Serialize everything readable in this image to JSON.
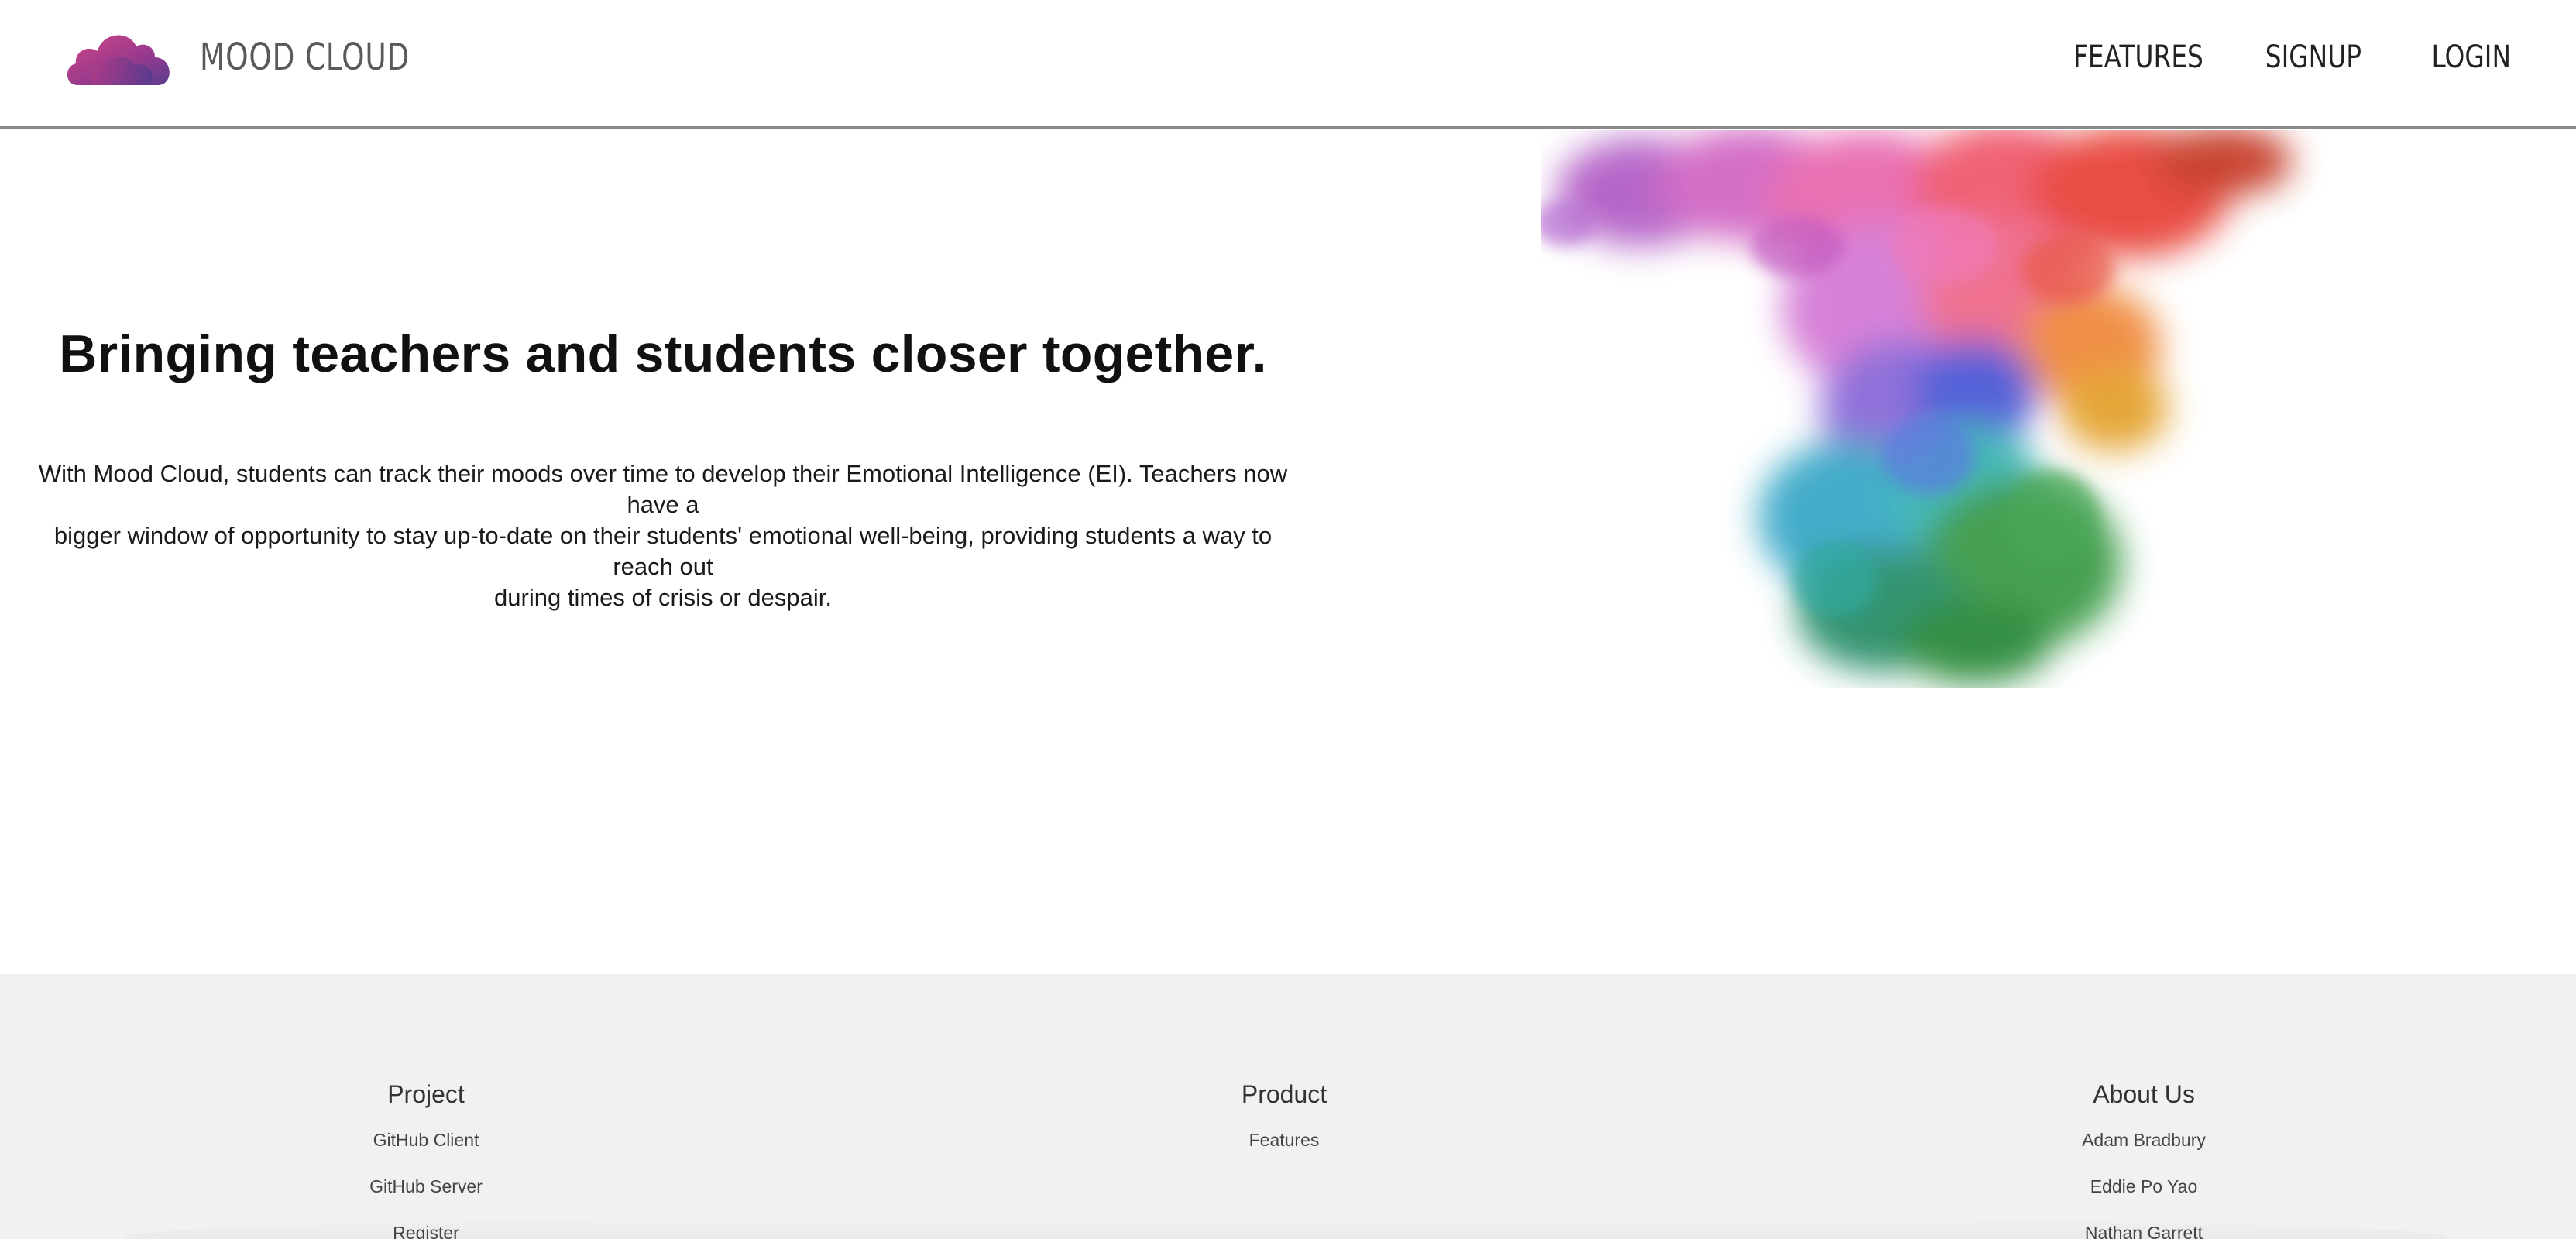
{
  "header": {
    "brand": "MOOD CLOUD",
    "nav": [
      {
        "label": "FEATURES"
      },
      {
        "label": "SIGNUP"
      },
      {
        "label": "LOGIN"
      }
    ]
  },
  "hero": {
    "title": "Bringing teachers and students closer together.",
    "description_lines": [
      "With Mood Cloud, students can track their moods over time to develop their Emotional Intelligence (EI). Teachers now have a",
      "bigger window of opportunity to stay up-to-date on their students' emotional well-being, providing students a way to reach out",
      "during times of crisis or despair."
    ]
  },
  "footer": {
    "columns": [
      {
        "title": "Project",
        "links": [
          "GitHub Client",
          "GitHub Server",
          "Register"
        ]
      },
      {
        "title": "Product",
        "links": [
          "Features"
        ]
      },
      {
        "title": "About Us",
        "links": [
          "Adam Bradbury",
          "Eddie Po Yao",
          "Nathan Garrett"
        ]
      }
    ]
  },
  "colors": {
    "header_border": "#8a8a8a",
    "footer_background": "#f1f1f1",
    "brand_text": "#5a5a5a",
    "logo_gradient": [
      "#c4407f",
      "#7a3a9c",
      "#5b3d8e"
    ]
  },
  "icons": {
    "logo": "cloud-logo-icon",
    "hero_image": "colorful-ink-smoke-image"
  }
}
